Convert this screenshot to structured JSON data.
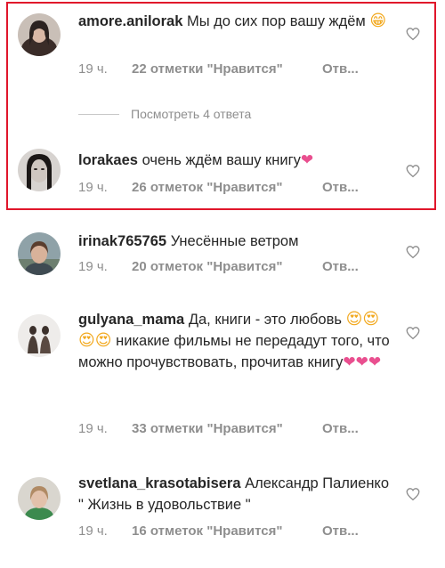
{
  "comments": [
    {
      "username": "amore.anilorak",
      "text": "Мы до сих пор вашу ждём",
      "emoji": "😁",
      "time": "19 ч.",
      "likes": "22 отметки \"Нравится\"",
      "reply": "Отв..."
    },
    {
      "username": "lorakaes",
      "text": "очень ждём вашу книгу",
      "emoji": "❤",
      "time": "19 ч.",
      "likes": "26 отметок \"Нравится\"",
      "reply": "Отв..."
    },
    {
      "username": "irinak765765",
      "text": "Унесённые ветром",
      "time": "19 ч.",
      "likes": "20 отметок \"Нравится\"",
      "reply": "Отв..."
    },
    {
      "username": "gulyana_mama",
      "text_part1": "Да, книги - это любовь",
      "emoji_faces": "😍😍😍😍",
      "text_part2": "никакие фильмы не передадут того, что можно прочувствовать, прочитав книгу",
      "emoji_hearts": "❤❤❤",
      "time": "19 ч.",
      "likes": "33 отметки \"Нравится\"",
      "reply": "Отв..."
    },
    {
      "username": "svetlana_krasotabisera",
      "text": "Александр Палиенко \" Жизнь в удовольствие \"",
      "time": "19 ч.",
      "likes": "16 отметок \"Нравится\"",
      "reply": "Отв..."
    }
  ],
  "view_replies": "Посмотреть 4 ответа",
  "colors": {
    "highlight": "#e0162b",
    "muted": "#8e8e8e",
    "heart": "#e94f8f"
  },
  "icons": {
    "like": "heart-outline-icon"
  }
}
